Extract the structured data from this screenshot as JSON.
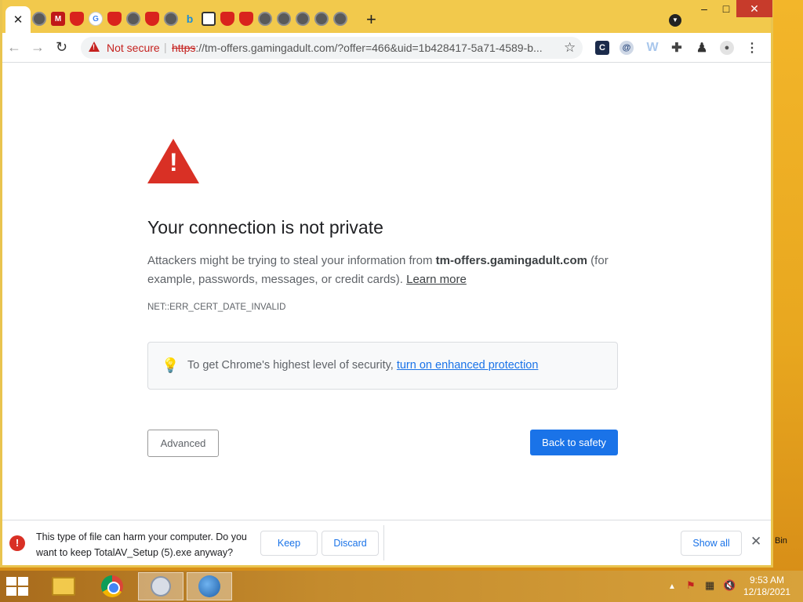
{
  "browser": {
    "tabs": [
      {
        "icon": "close-icon",
        "active": true
      },
      {
        "icon": "globe-icon"
      },
      {
        "icon": "mcafee-icon"
      },
      {
        "icon": "shield-icon"
      },
      {
        "icon": "google-icon"
      },
      {
        "icon": "shield-icon"
      },
      {
        "icon": "globe-icon"
      },
      {
        "icon": "shield-icon"
      },
      {
        "icon": "globe-icon"
      },
      {
        "icon": "bing-icon"
      },
      {
        "icon": "shield-icon"
      },
      {
        "icon": "shield-icon"
      },
      {
        "icon": "shield-icon"
      },
      {
        "icon": "globe-icon"
      },
      {
        "icon": "globe-icon"
      },
      {
        "icon": "globe-icon"
      },
      {
        "icon": "globe-icon"
      },
      {
        "icon": "globe-icon"
      }
    ],
    "new_tab_glyph": "+",
    "window_controls": {
      "minimize": "–",
      "maximize": "□",
      "close": "✕"
    },
    "address_bar": {
      "security_label": "Not secure",
      "scheme": "https",
      "url_rest": "://tm-offers.gamingadult.com/?offer=466&uid=1b428417-5a71-4589-b..."
    }
  },
  "page": {
    "heading": "Your connection is not private",
    "desc_before": "Attackers might be trying to steal your information from ",
    "desc_domain": "tm-offers.gamingadult.com",
    "desc_after": " (for example, passwords, messages, or credit cards). ",
    "learn_more": "Learn more",
    "error_code": "NET::ERR_CERT_DATE_INVALID",
    "enhanced_text": "To get Chrome's highest level of security, ",
    "enhanced_link": "turn on enhanced protection",
    "advanced_button": "Advanced",
    "safety_button": "Back to safety"
  },
  "download_shelf": {
    "message": "This type of file can harm your computer. Do you want to keep TotalAV_Setup (5).exe anyway?",
    "keep": "Keep",
    "discard": "Discard",
    "show_all": "Show all"
  },
  "desktop": {
    "partial_label": "Bin"
  },
  "taskbar": {
    "time": "9:53 AM",
    "date": "12/18/2021"
  }
}
